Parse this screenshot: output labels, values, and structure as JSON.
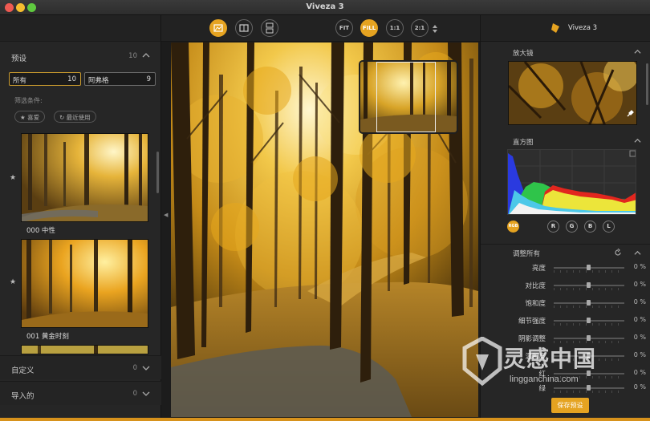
{
  "window": {
    "title": "Viveza 3"
  },
  "left_panel": {
    "presets": {
      "title": "预设",
      "count": "10"
    },
    "fields": [
      {
        "label": "所有",
        "count": "10"
      },
      {
        "label": "阿弗格",
        "count": "9"
      }
    ],
    "filter_label": "筛选条件:",
    "filters": [
      "喜爱",
      "最近使用"
    ],
    "thumbnails": [
      {
        "label": "000 中性"
      },
      {
        "label": "001 黄金时刻"
      }
    ],
    "custom": {
      "title": "自定义",
      "count": "0"
    },
    "imported": {
      "title": "导入的",
      "count": "0"
    }
  },
  "toolbar": {
    "fit_label": "FIT",
    "fill_label": "FILL",
    "one_label": "1:1",
    "two_label": "2:1"
  },
  "right_panel": {
    "app_title": "Viveza 3",
    "loupe_title": "放大镜",
    "histogram_title": "直方图",
    "channels": [
      "RGB",
      "R",
      "G",
      "B",
      "L"
    ],
    "adjust_title": "调整所有",
    "adjustments": [
      {
        "label": "亮度",
        "value": "0 %"
      },
      {
        "label": "对比度",
        "value": "0 %"
      },
      {
        "label": "饱和度",
        "value": "0 %"
      },
      {
        "label": "细节强度",
        "value": "0 %"
      },
      {
        "label": "阴影调整",
        "value": "0 %"
      },
      {
        "label": "温和度",
        "value": "0 %"
      },
      {
        "label": "红",
        "value": "0 %"
      },
      {
        "label": "绿",
        "value": "0 %"
      }
    ],
    "save_label": "保存预设"
  },
  "watermark": {
    "cn": "灵感中国",
    "url": "lingganchina.com"
  },
  "colors": {
    "accent": "#e5a321",
    "panel": "#262626"
  }
}
